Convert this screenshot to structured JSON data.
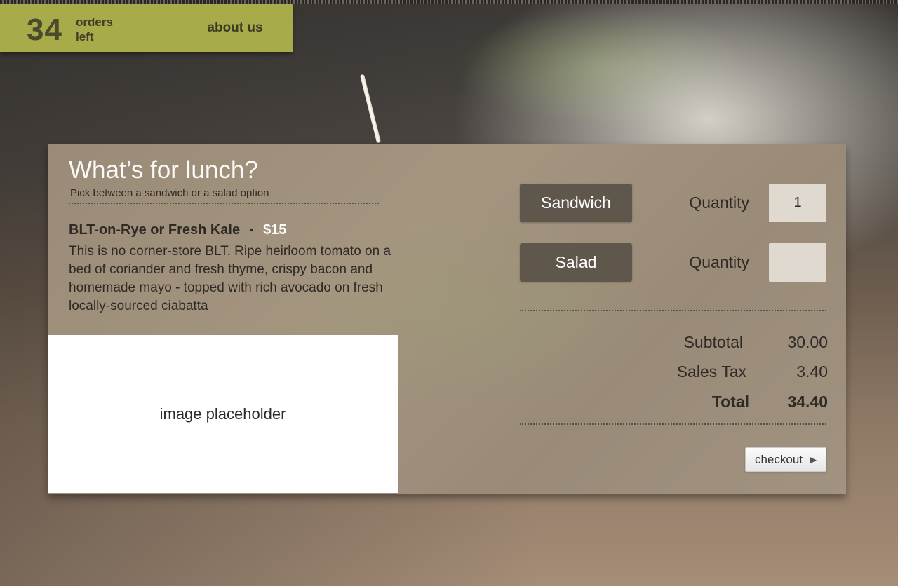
{
  "topbar": {
    "count": "34",
    "count_label_1": "orders",
    "count_label_2": "left",
    "about_label": "about us"
  },
  "panel": {
    "title": "What’s for lunch?",
    "subtitle": "Pick between a sandwich or a salad option",
    "item": {
      "name": "BLT-on-Rye or Fresh Kale",
      "separator": "▪",
      "price": "$15",
      "description": "This is no corner-store BLT. Ripe heirloom tomato on a bed of coriander and fresh thyme, crispy bacon and homemade mayo - topped with rich avocado on fresh locally-sourced ciabatta"
    },
    "image_placeholder": "image placeholder"
  },
  "options": [
    {
      "label": "Sandwich",
      "quantity_label": "Quantity",
      "quantity_value": "1"
    },
    {
      "label": "Salad",
      "quantity_label": "Quantity",
      "quantity_value": ""
    }
  ],
  "summary": {
    "subtotal_label": "Subtotal",
    "subtotal_value": "30.00",
    "tax_label": "Sales Tax",
    "tax_value": "3.40",
    "total_label": "Total",
    "total_value": "34.40"
  },
  "checkout": {
    "label": "checkout",
    "icon": "▶"
  },
  "colors": {
    "topbar_bg": "#a8ab49",
    "option_button_bg": "#5f564c",
    "panel_bg": "#a4957f"
  }
}
